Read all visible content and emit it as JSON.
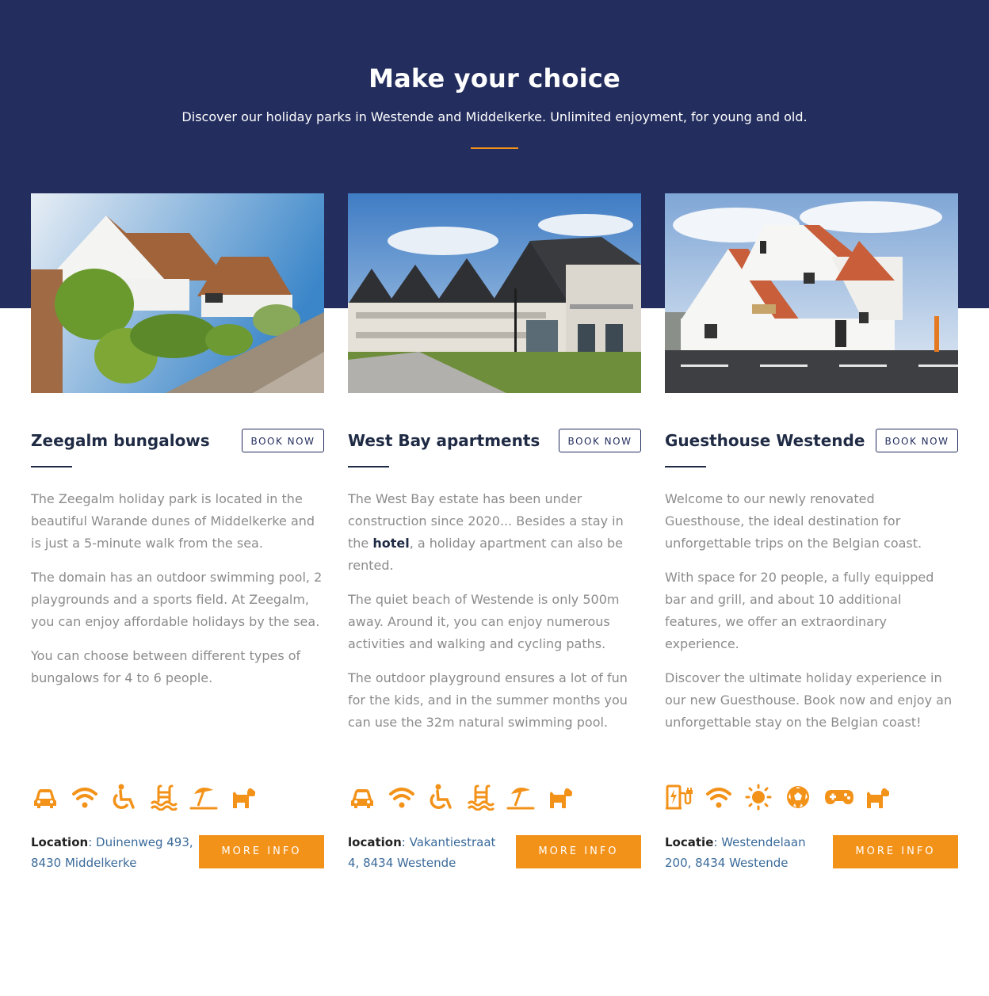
{
  "hero": {
    "title": "Make your choice",
    "subtitle": "Discover our holiday parks in Westende and Middelkerke. Unlimited enjoyment, for young and old."
  },
  "colors": {
    "navy": "#232d5e",
    "orange": "#f39219",
    "body_text": "#8b8b8b",
    "link": "#3a6a9a"
  },
  "cards": [
    {
      "title": "Zeegalm bungalows",
      "book_label": "BOOK NOW",
      "photo": "bungalow-photo",
      "paragraphs": [
        "The Zeegalm holiday park is located in the beautiful Warande dunes of Middelkerke and is just a 5-minute walk from the sea.",
        "The domain has an outdoor swimming pool, 2 playgrounds and a sports field. At Zeegalm, you can enjoy affordable holidays by the sea.",
        "You can choose between different types of bungalows for 4 to 6 people."
      ],
      "icons": [
        "car-icon",
        "wifi-icon",
        "wheelchair-icon",
        "pool-icon",
        "beach-icon",
        "dog-icon"
      ],
      "location_label": "Location",
      "location_value": "Duinenweg 493, 8430 Middelkerke",
      "more_label": "MORE INFO"
    },
    {
      "title": "West Bay apartments",
      "book_label": "BOOK NOW",
      "photo": "apartments-photo",
      "p1_before": "The West Bay estate has been under construction since 2020... Besides a stay in the ",
      "p1_bold": "hotel",
      "p1_after": ", a holiday apartment can also be rented.",
      "paragraphs": [
        "The quiet beach of Westende is only 500m away. Around it, you can enjoy numerous activities and walking and cycling paths.",
        "The outdoor playground ensures a lot of fun for the kids, and in the summer months you can use the 32m natural swimming pool."
      ],
      "icons": [
        "car-icon",
        "wifi-icon",
        "wheelchair-icon",
        "pool-icon",
        "beach-icon",
        "dog-icon"
      ],
      "location_label": "location",
      "location_value": "Vakantiestraat 4, 8434 Westende",
      "more_label": "MORE INFO"
    },
    {
      "title": "Guesthouse Westende",
      "book_label": "BOOK NOW",
      "photo": "guesthouse-photo",
      "paragraphs": [
        "Welcome to our newly renovated Guesthouse, the ideal destination for unforgettable trips on the Belgian coast.",
        "With space for 20 people, a fully equipped bar and grill, and about 10 additional features, we offer an extraordinary experience.",
        "Discover the ultimate holiday experience in our new Guesthouse. Book now and enjoy an unforgettable stay on the Belgian coast!"
      ],
      "icons": [
        "ev-charger-icon",
        "wifi-icon",
        "sun-icon",
        "football-icon",
        "gamepad-icon",
        "dog-icon"
      ],
      "location_label": "Locatie",
      "location_value": "Westendelaan 200, 8434 Westende",
      "more_label": "MORE INFO"
    }
  ]
}
